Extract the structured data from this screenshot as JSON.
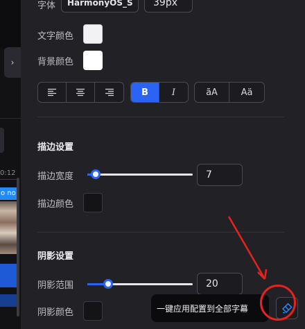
{
  "left_strip": {
    "collapse_glyph": "›",
    "time": "0:12",
    "clip_label": "o no"
  },
  "font": {
    "label": "字体",
    "family_value": "HarmonyOS_S",
    "size_value": "39px"
  },
  "text_color": {
    "label": "文字颜色",
    "value": "#f2f2f5"
  },
  "bg_color": {
    "label": "背景颜色",
    "value": "#ffffff"
  },
  "align_group": [
    {
      "name": "align-left-icon"
    },
    {
      "name": "align-center-icon"
    },
    {
      "name": "align-right-icon"
    }
  ],
  "style_group": [
    {
      "label": "B",
      "active": true
    },
    {
      "label": "I",
      "active": false
    }
  ],
  "case_group": [
    {
      "label": "ãA"
    },
    {
      "label": "Aä"
    }
  ],
  "stroke": {
    "title": "描边设置",
    "width_label": "描边宽度",
    "width_value": "7",
    "width_level": 0.08,
    "color_label": "描边颜色",
    "color_value": "#141416"
  },
  "shadow": {
    "title": "阴影设置",
    "range_label": "阴影范围",
    "range_value": "20",
    "range_level": 0.2,
    "color_label": "阴影颜色",
    "color_value": "#141416"
  },
  "tooltip": {
    "text": "一键应用配置到全部字幕"
  },
  "colors": {
    "accent": "#2b63f5",
    "annotation": "#e8231f"
  }
}
